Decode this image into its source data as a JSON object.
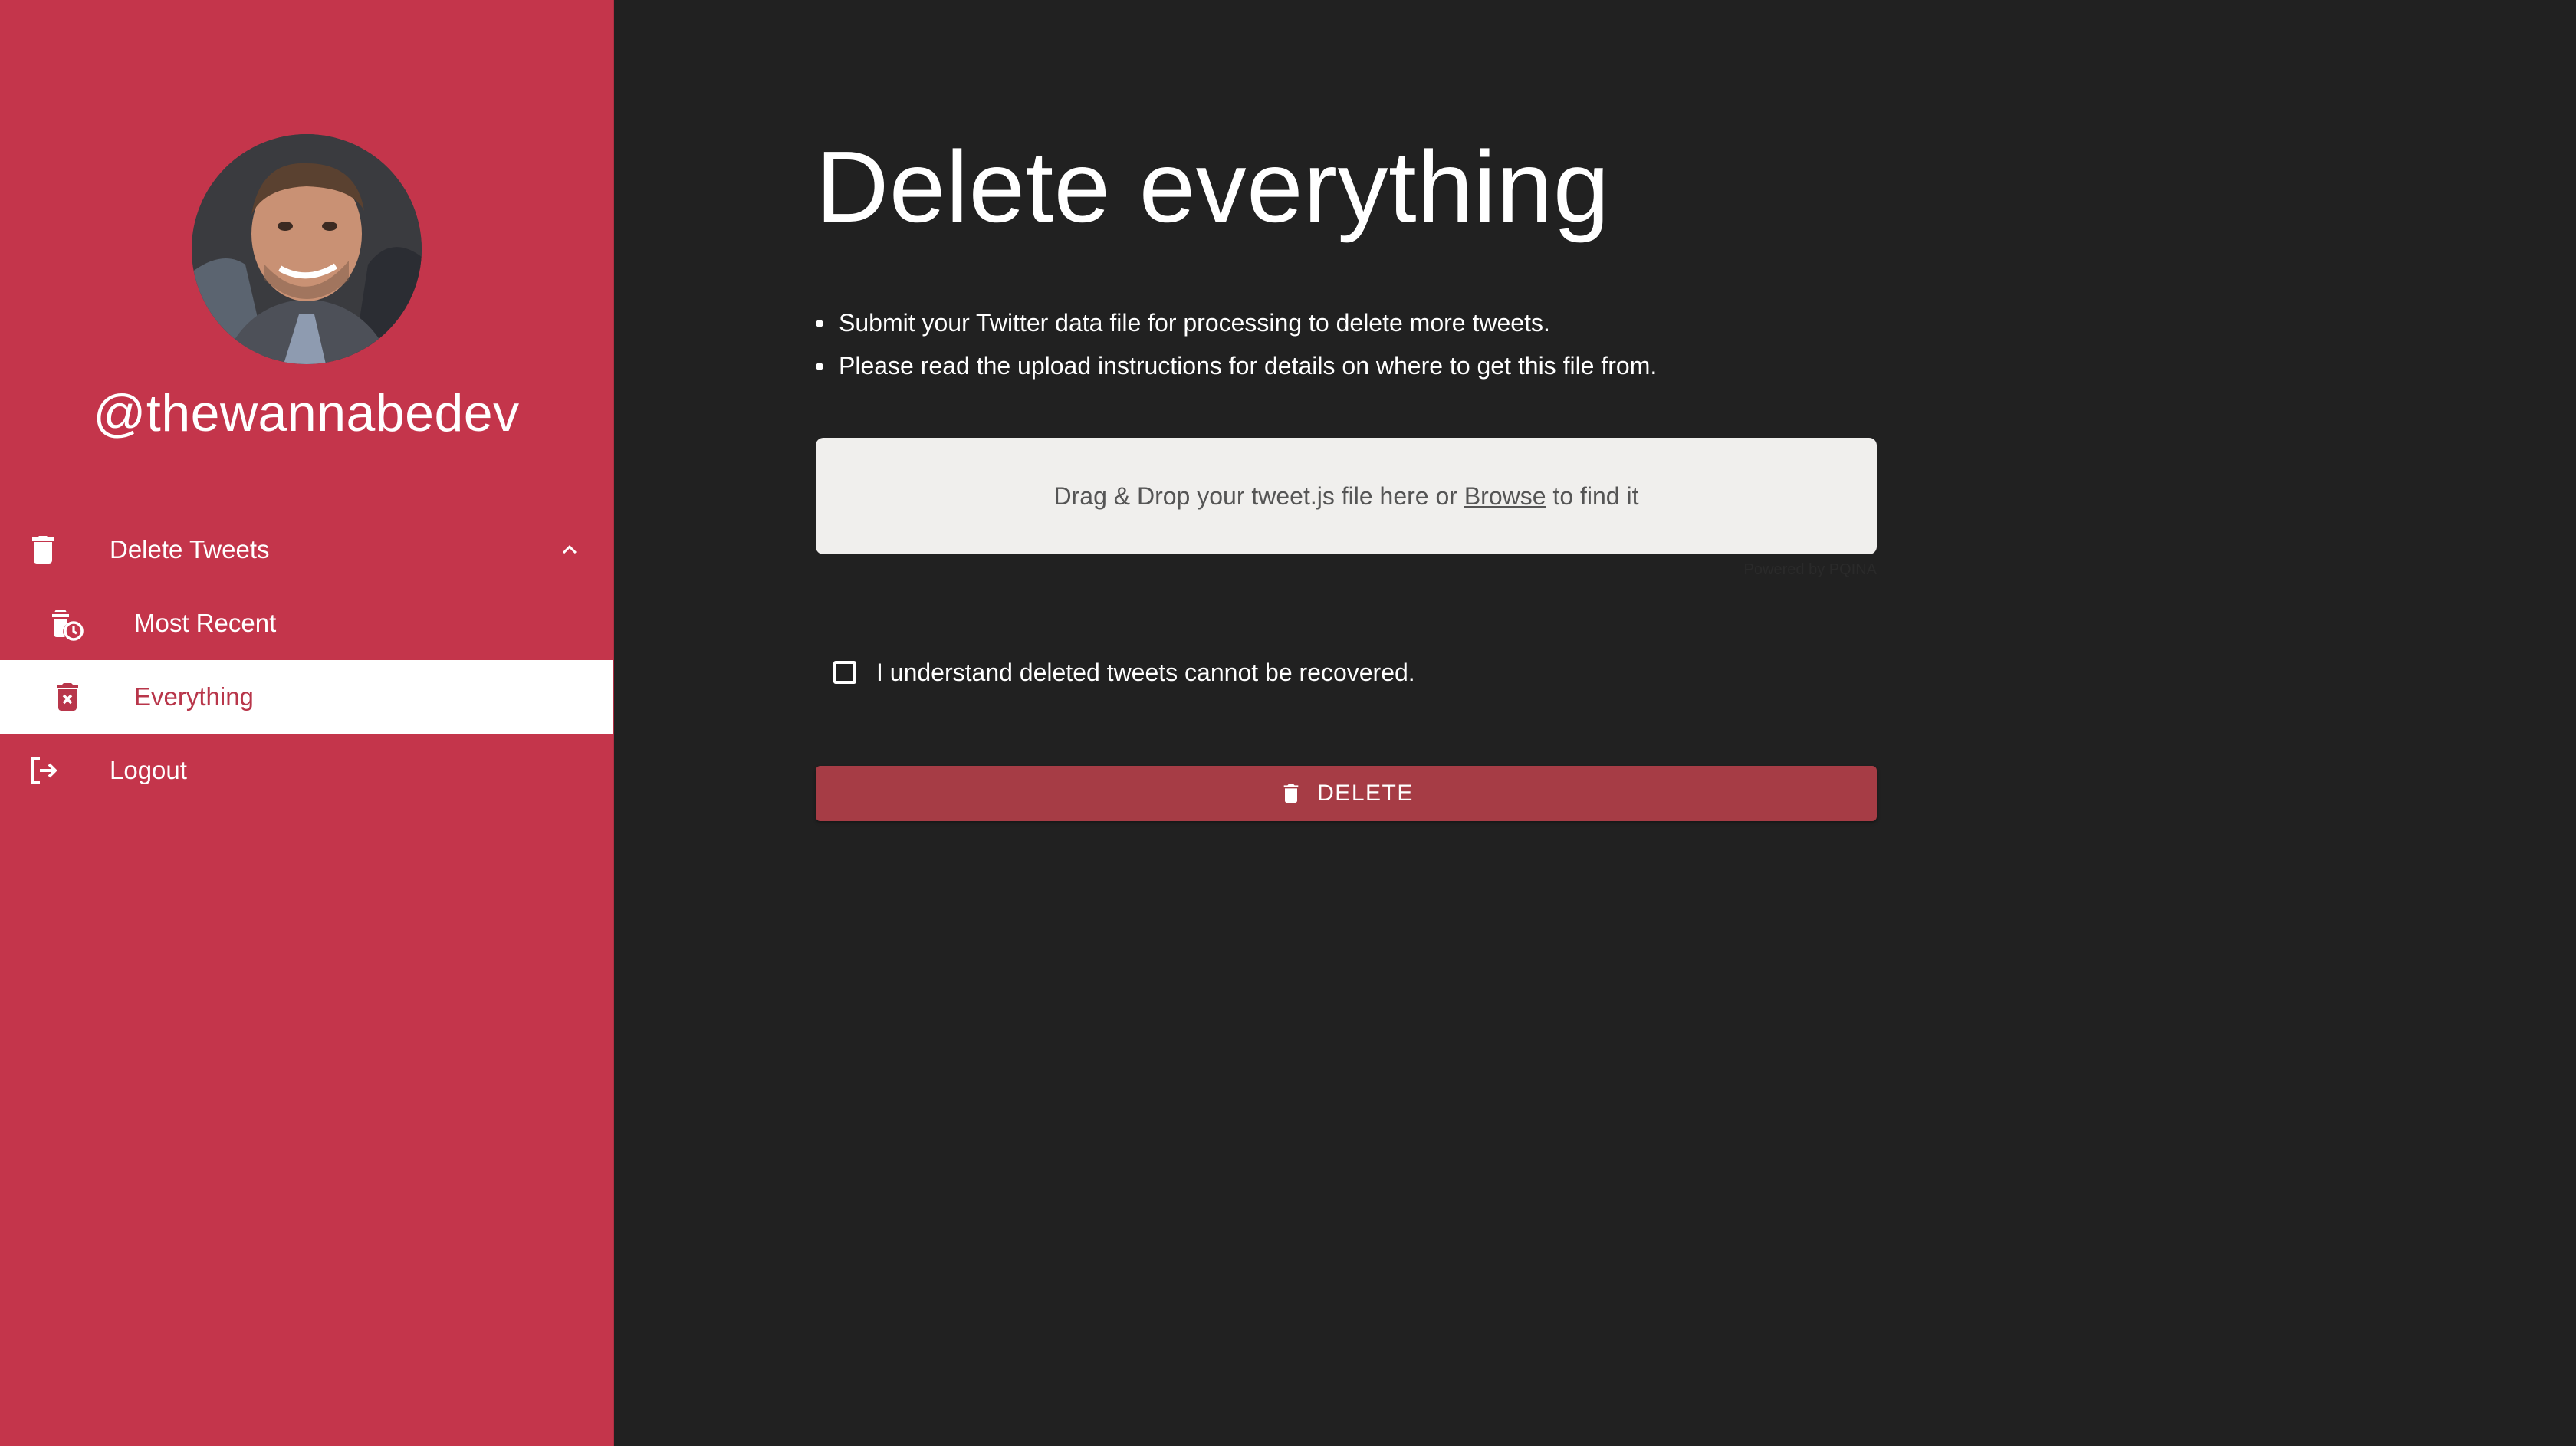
{
  "user": {
    "username": "@thewannabedev"
  },
  "sidebar": {
    "items": [
      {
        "label": "Delete Tweets",
        "icon": "trash-icon",
        "expanded": true
      },
      {
        "label": "Most Recent",
        "icon": "trash-clock-icon"
      },
      {
        "label": "Everything",
        "icon": "trash-x-icon",
        "active": true
      },
      {
        "label": "Logout",
        "icon": "logout-icon"
      }
    ]
  },
  "main": {
    "title": "Delete everything",
    "bullets": [
      "Submit your Twitter data file for processing to delete more tweets.",
      "Please read the upload instructions for details on where to get this file from."
    ],
    "dropzone": {
      "text_before": "Drag & Drop your tweet.js file here or ",
      "browse_label": "Browse",
      "text_after": " to find it",
      "powered_by": "Powered by PQINA"
    },
    "confirm_label": "I understand deleted tweets cannot be recovered.",
    "confirm_checked": false,
    "delete_button_label": "DELETE"
  },
  "colors": {
    "sidebar_bg": "#c4354b",
    "main_bg": "#212121",
    "button_bg": "#a63c45",
    "dropzone_bg": "#f0efed",
    "active_text": "#b8364a"
  }
}
